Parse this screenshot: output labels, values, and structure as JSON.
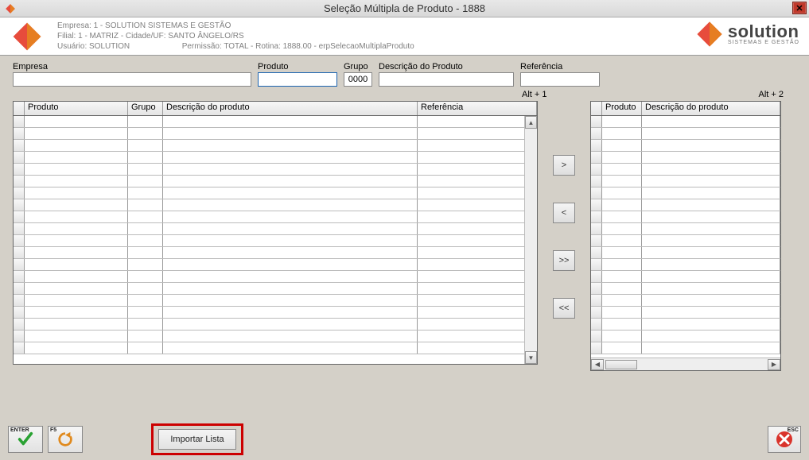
{
  "window": {
    "title": "Seleção Múltipla de Produto - 1888"
  },
  "header": {
    "line1": "Empresa: 1 - SOLUTION SISTEMAS E GESTÃO",
    "line2": "Filial: 1 - MATRIZ - Cidade/UF: SANTO ÂNGELO/RS",
    "line3_user": "Usuário: SOLUTION",
    "line3_perm": "Permissão: TOTAL - Rotina: 1888.00 - erpSelecaoMultiplaProduto",
    "brand": "solution",
    "brand_sub": "SISTEMAS E GESTÃO"
  },
  "filters": {
    "empresa_label": "Empresa",
    "empresa_value": "",
    "produto_label": "Produto",
    "produto_value": "",
    "grupo_label": "Grupo",
    "grupo_value": "0000",
    "desc_label": "Descrição do Produto",
    "desc_value": "",
    "ref_label": "Referência",
    "ref_value": ""
  },
  "shortcuts": {
    "alt1": "Alt + 1",
    "alt2": "Alt + 2"
  },
  "grid_left": {
    "cols": {
      "c1": "Produto",
      "c2": "Grupo",
      "c3": "Descrição do produto",
      "c4": "Referência"
    }
  },
  "grid_right": {
    "cols": {
      "c1": "Produto",
      "c2": "Descrição do produto"
    }
  },
  "transfer": {
    "add": ">",
    "remove": "<",
    "add_all": ">>",
    "remove_all": "<<"
  },
  "bottom": {
    "enter_hint": "ENTER",
    "f5_hint": "F5",
    "importar": "Importar Lista",
    "esc_hint": "ESC"
  }
}
